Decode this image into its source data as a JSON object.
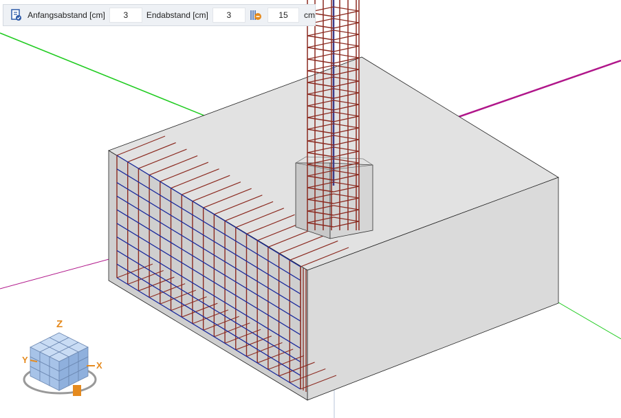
{
  "toolbar": {
    "start_distance_label": "Anfangsabstand [cm]",
    "start_distance_value": "3",
    "end_distance_label": "Endabstand [cm]",
    "end_distance_value": "3",
    "spacing_value": "15",
    "spacing_unit": "cm",
    "rebar_settings_icon": "rebar-settings-icon",
    "spacing_icon": "bar-spacing-icon"
  },
  "nav_cube": {
    "icon": "view-cube-icon",
    "axis_z": "Z",
    "axis_x": "X",
    "axis_y": "Y"
  },
  "colors": {
    "axis_green": "#22cc22",
    "axis_magenta": "#b0168a",
    "rebar_red": "#8b2a20",
    "rebar_blue": "#1a2a9c",
    "concrete_fill": "#cfcfcf",
    "toolbar_bg": "#eef1f5",
    "cube_blue": "#a7c3e8"
  }
}
